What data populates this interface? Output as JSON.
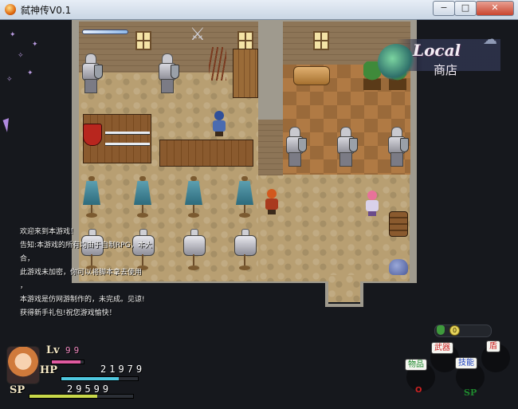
{
  "window": {
    "title": "弑神传V0.1",
    "minimize_glyph": "−",
    "maximize_glyph": "□",
    "close_glyph": "✕"
  },
  "location": {
    "title": "Local",
    "subtitle": "商店"
  },
  "message_log": [
    "欢迎来到本游戏！",
    "告知:本游戏的所有均由于自制RPG，本大",
    "合，",
    "此游戏未加密，你可以将脚本拿去使用",
    "，",
    "本游戏是仿网游制作的，未完成。见谅!",
    "获得新手礼包!祝您游戏愉快！"
  ],
  "status": {
    "level_label": "Lv",
    "level_value": "99",
    "hp_label": "HP",
    "hp_value": "21979",
    "hp_fraction": 0.75,
    "sp_label": "SP",
    "sp_value": "29599",
    "sp_fraction": 0.65,
    "level_fraction": 0.9
  },
  "menu": {
    "gold_value": "0",
    "weapon_label": "武器",
    "shield_label": "盾",
    "items_label": "物品",
    "skills_label": "技能",
    "o_label": "O",
    "sp_label": "SP"
  },
  "colors": {
    "hp_bar": "#4fc8e0",
    "sp_bar": "#c8d84a",
    "level_bar": "#e05aa0",
    "menu_red": "#cc2222",
    "menu_green": "#1f8a2e",
    "menu_blue": "#1a3fbf"
  }
}
